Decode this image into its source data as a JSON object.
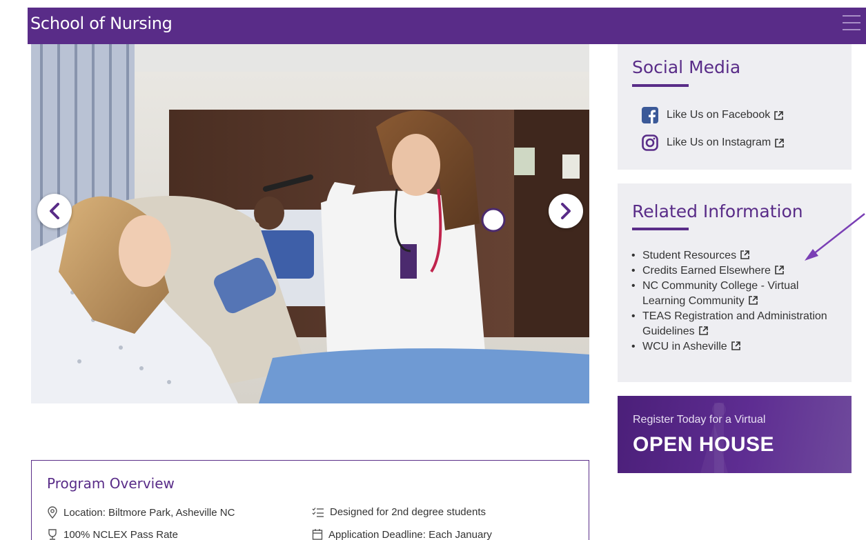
{
  "header": {
    "site_title": "School of Nursing"
  },
  "carousel": {
    "image": "nursing-simulation-lab-photo"
  },
  "social": {
    "heading": "Social Media",
    "facebook_label": "Like Us on Facebook",
    "instagram_label": "Like Us on Instagram"
  },
  "related": {
    "heading": "Related Information",
    "items": [
      "Student Resources",
      "Credits Earned Elsewhere",
      "NC Community College - Virtual Learning Community",
      "TEAS Registration and Administration Guidelines",
      "WCU in Asheville"
    ]
  },
  "open_house": {
    "line1": "Register Today for a Virtual",
    "line2": "OPEN HOUSE"
  },
  "overview": {
    "title": "Program Overview",
    "location": "Location: Biltmore Park, Asheville NC",
    "designed": "Designed for 2nd degree students",
    "pass_rate": "100% NCLEX Pass Rate",
    "deadline": "Application Deadline: Each January"
  },
  "colors": {
    "brand_purple": "#592c88",
    "panel_bg": "#eeeef2",
    "facebook_blue": "#3b5998"
  }
}
